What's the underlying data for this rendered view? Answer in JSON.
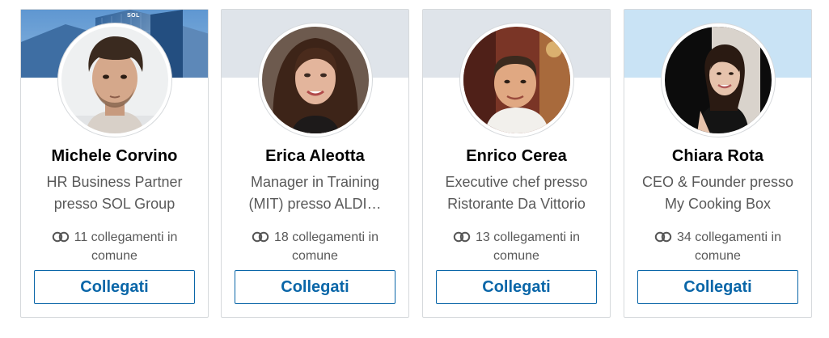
{
  "cards": [
    {
      "name": "Michele Corvino",
      "headline_line1": "HR Business Partner",
      "headline_line2": "presso SOL Group",
      "shared_line1": "11 collegamenti in",
      "shared_line2": "comune",
      "button_label": "Collegati",
      "banner_text": "SOL"
    },
    {
      "name": "Erica Aleotta",
      "headline_line1": "Manager in Training",
      "headline_line2": "(MIT) presso ALDI…",
      "shared_line1": "18 collegamenti in",
      "shared_line2": "comune",
      "button_label": "Collegati"
    },
    {
      "name": "Enrico Cerea",
      "headline_line1": "Executive chef presso",
      "headline_line2": "Ristorante Da Vittorio",
      "shared_line1": "13 collegamenti in",
      "shared_line2": "comune",
      "button_label": "Collegati"
    },
    {
      "name": "Chiara Rota",
      "headline_line1": "CEO & Founder presso",
      "headline_line2": "My Cooking Box",
      "shared_line1": "34 collegamenti in",
      "shared_line2": "comune",
      "button_label": "Collegati"
    }
  ],
  "colors": {
    "accent": "#0a66a8",
    "border": "#d6d9dc",
    "name_text": "#000000",
    "secondary_text": "#595959"
  },
  "icons": {
    "shared_connections": "shared-connections-icon"
  }
}
